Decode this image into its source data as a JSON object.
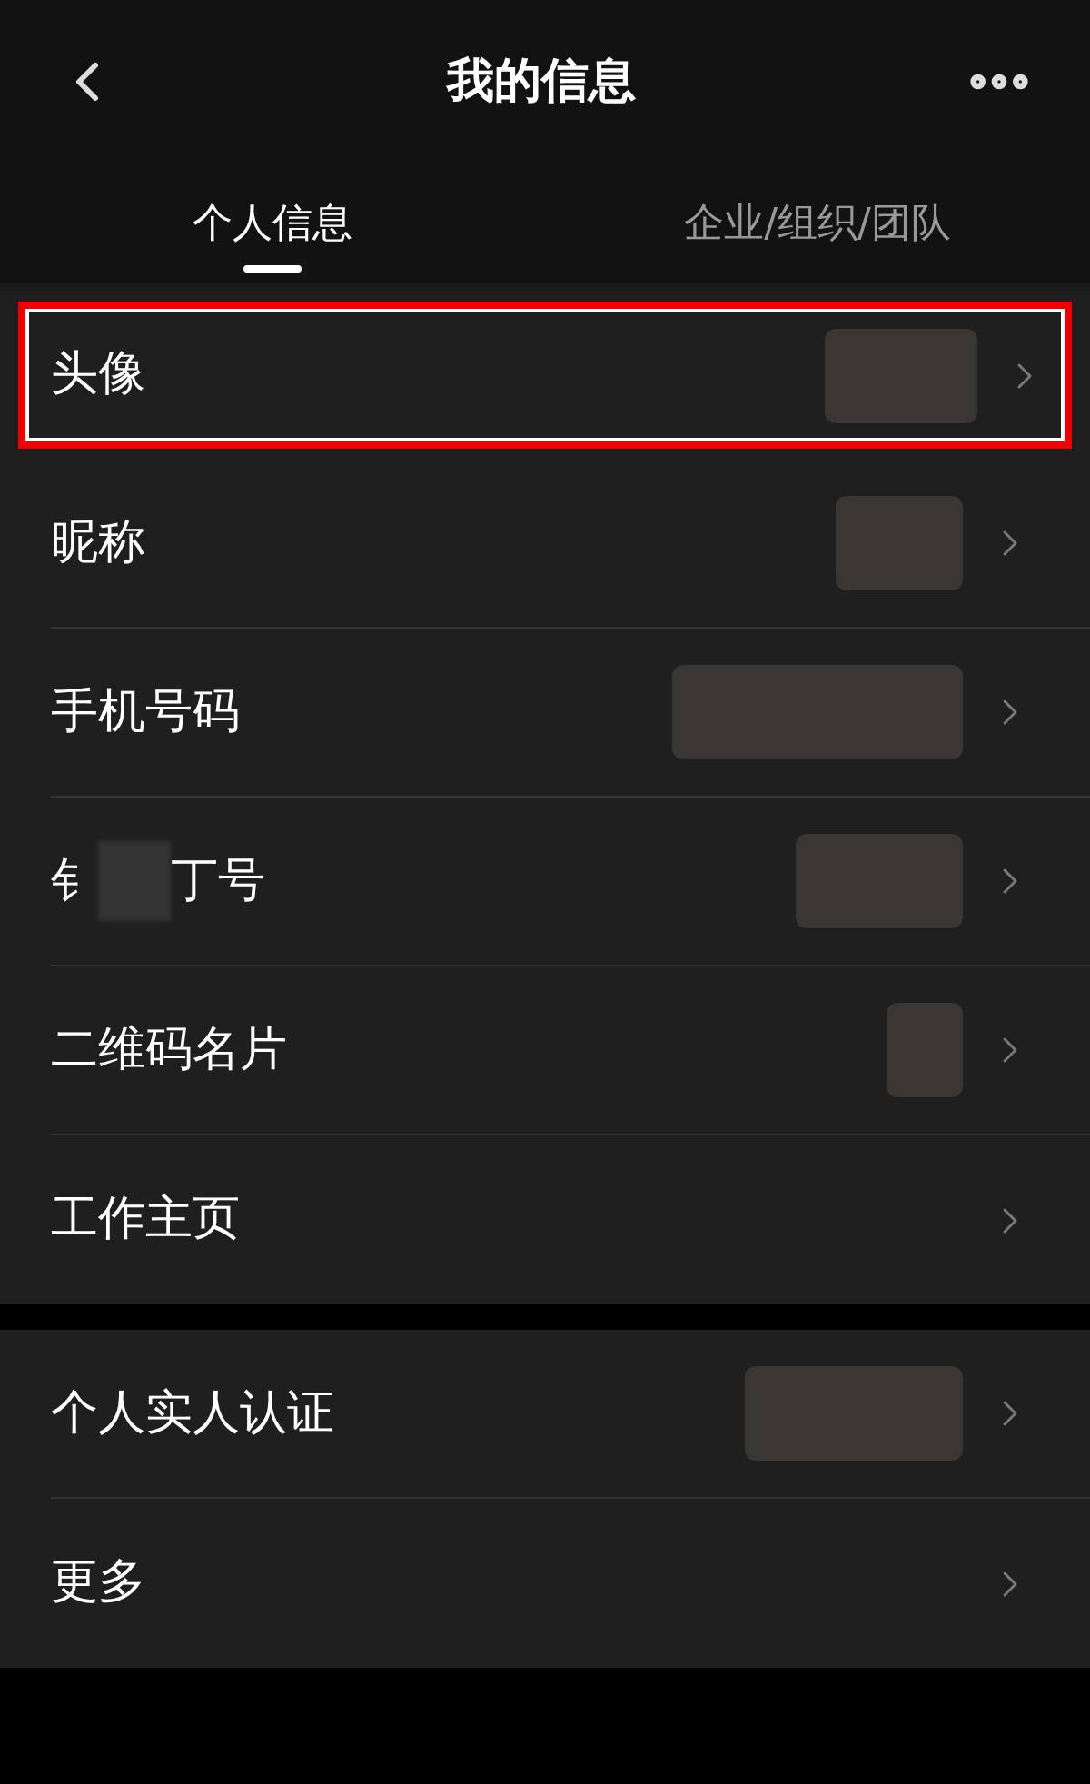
{
  "header": {
    "title": "我的信息"
  },
  "tabs": [
    {
      "label": "个人信息",
      "selected": true
    },
    {
      "label": "企业/组织/团队",
      "selected": false
    }
  ],
  "sections": [
    {
      "rows": [
        {
          "label": "头像",
          "blurred_value": true,
          "highlighted": true
        },
        {
          "label": "昵称",
          "blurred_value": true,
          "highlighted": false
        },
        {
          "label": "手机号码",
          "blurred_value": true,
          "highlighted": false
        },
        {
          "label_parts": [
            "钅",
            "丁号"
          ],
          "blurred_value": true,
          "highlighted": false
        },
        {
          "label": "二维码名片",
          "blurred_value": true,
          "highlighted": false
        },
        {
          "label": "工作主页",
          "blurred_value": false,
          "highlighted": false
        }
      ]
    },
    {
      "rows": [
        {
          "label": "个人实人认证",
          "blurred_value": true,
          "highlighted": false
        },
        {
          "label": "更多",
          "blurred_value": false,
          "highlighted": false
        }
      ]
    }
  ]
}
